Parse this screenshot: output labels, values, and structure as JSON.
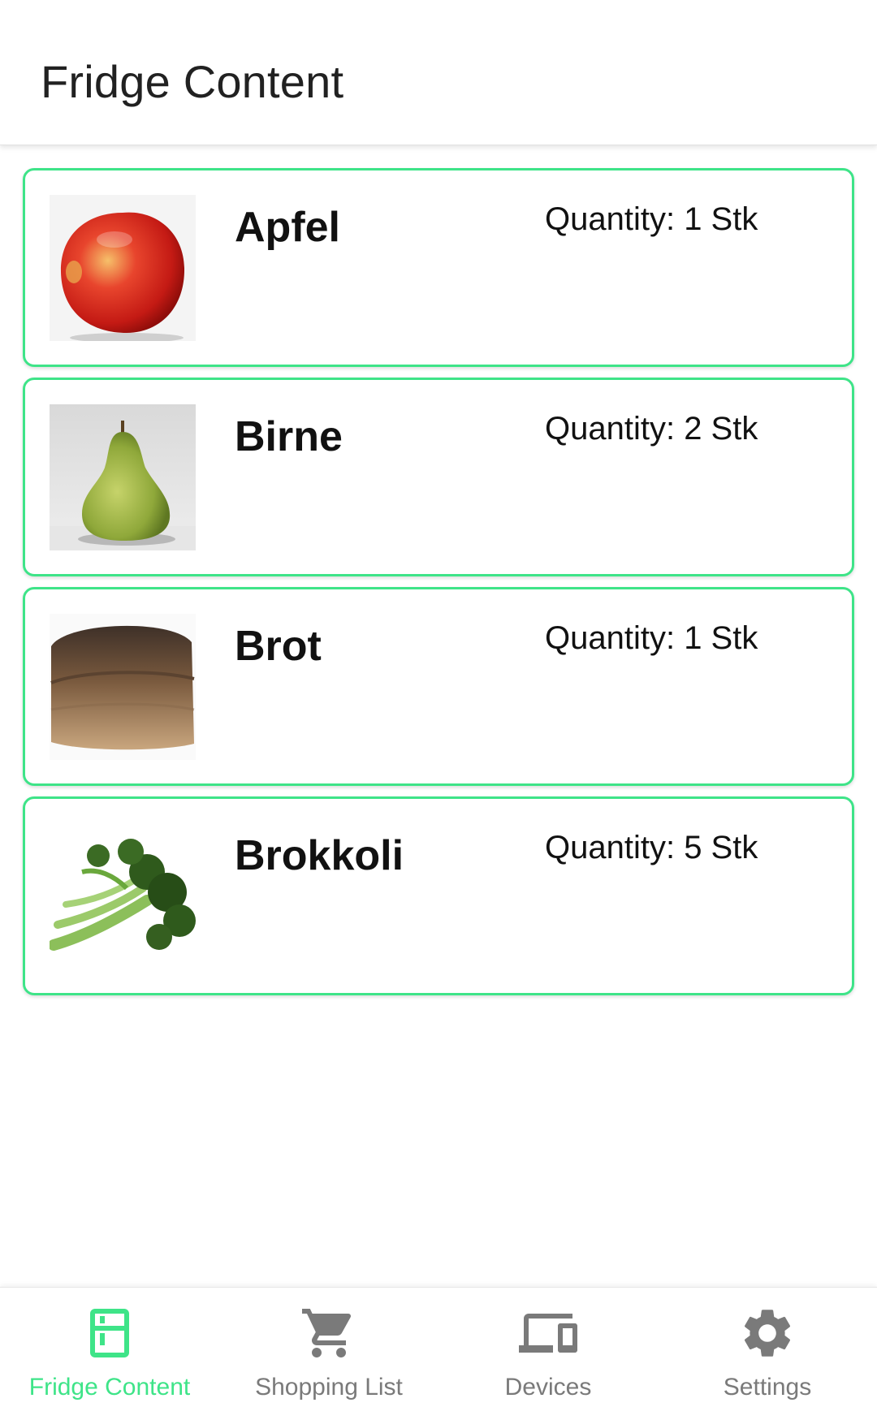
{
  "header": {
    "title": "Fridge Content"
  },
  "items": [
    {
      "name": "Apfel",
      "quantity": "Quantity: 1 Stk",
      "image": "apple-photo"
    },
    {
      "name": "Birne",
      "quantity": "Quantity: 2 Stk",
      "image": "pear-photo"
    },
    {
      "name": "Brot",
      "quantity": "Quantity: 1 Stk",
      "image": "bread-photo"
    },
    {
      "name": "Brokkoli",
      "quantity": "Quantity: 5 Stk",
      "image": "broccoli-photo"
    }
  ],
  "bottom_nav": {
    "active": "Fridge Content",
    "items": [
      {
        "label": "Fridge Content",
        "icon": "fridge-icon"
      },
      {
        "label": "Shopping List",
        "icon": "cart-icon"
      },
      {
        "label": "Devices",
        "icon": "devices-icon"
      },
      {
        "label": "Settings",
        "icon": "gear-icon"
      }
    ]
  },
  "colors": {
    "accent": "#3ee488",
    "inactive": "#7a7a7a",
    "text": "#111111"
  }
}
